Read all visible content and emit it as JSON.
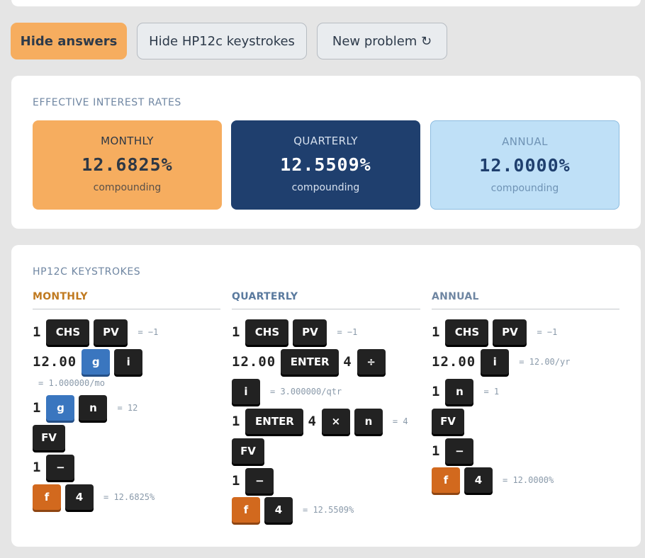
{
  "buttons": {
    "hide_answers": "Hide answers",
    "hide_keystrokes": "Hide HP12c keystrokes",
    "new_problem": "New problem ↻"
  },
  "rates": {
    "title": "EFFECTIVE INTEREST RATES",
    "monthly": {
      "label": "MONTHLY",
      "value": "12.6825%",
      "sub": "compounding"
    },
    "quarterly": {
      "label": "QUARTERLY",
      "value": "12.5509%",
      "sub": "compounding"
    },
    "annual": {
      "label": "ANNUAL",
      "value": "12.0000%",
      "sub": "compounding"
    }
  },
  "keystrokes": {
    "title": "HP12C KEYSTROKES",
    "monthly_head": "MONTHLY",
    "quarterly_head": "QUARTERLY",
    "annual_head": "ANNUAL",
    "num_1": "1",
    "num_4": "4",
    "num_12": "12.00",
    "key_chs": "CHS",
    "key_pv": "PV",
    "key_g": "g",
    "key_i": "i",
    "key_n": "n",
    "key_fv": "FV",
    "key_minus": "−",
    "key_f": "f",
    "key_4": "4",
    "key_enter": "ENTER",
    "key_div": "÷",
    "key_mul": "×",
    "res_neg1": "= −1",
    "res_m_i": "= 1.000000/mo",
    "res_m_n": "= 12",
    "res_m_final": "= 12.6825%",
    "res_q_i": "= 3.000000/qtr",
    "res_q_n": "= 4",
    "res_q_final": "= 12.5509%",
    "res_a_i": "= 12.00/yr",
    "res_a_n": "= 1",
    "res_a_final": "= 12.0000%"
  },
  "colors": {
    "accent_orange": "#f6ad5f",
    "navy": "#1f3f6e",
    "light_blue": "#bfe0f7"
  }
}
